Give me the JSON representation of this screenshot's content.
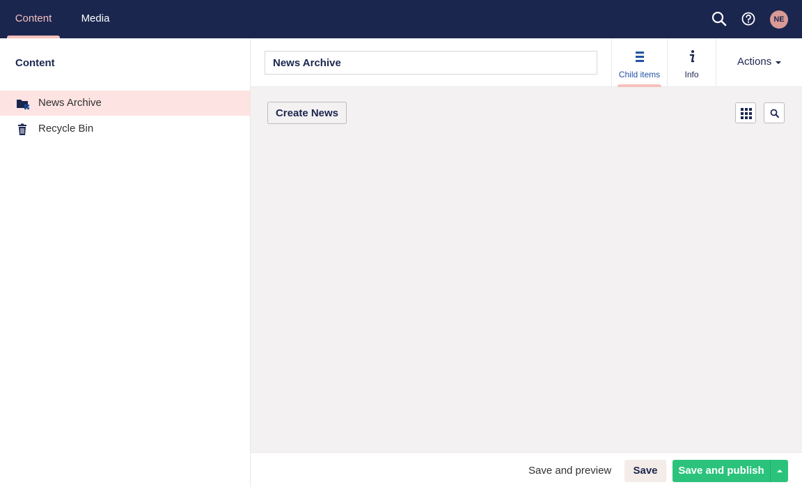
{
  "header": {
    "sections": [
      {
        "label": "Content",
        "active": true
      },
      {
        "label": "Media",
        "active": false
      }
    ],
    "search_icon": "search-icon",
    "help_icon": "help-icon",
    "user_initials": "NE"
  },
  "sidebar": {
    "title": "Content",
    "items": [
      {
        "label": "News Archive",
        "icon": "folder-icon",
        "active": true
      },
      {
        "label": "Recycle Bin",
        "icon": "trash-icon",
        "active": false
      }
    ]
  },
  "editor": {
    "name_value": "News Archive",
    "tabs": [
      {
        "label": "Child items",
        "icon": "list-icon",
        "active": true
      },
      {
        "label": "Info",
        "icon": "info-icon",
        "active": false
      }
    ],
    "actions_label": "Actions"
  },
  "content": {
    "create_label": "Create News",
    "grid_view_icon": "grid-icon",
    "search_icon": "search-icon"
  },
  "footer": {
    "preview_label": "Save and preview",
    "save_label": "Save",
    "publish_label": "Save and publish"
  },
  "colors": {
    "header_bg": "#1b264f",
    "accent": "#f5c1bc",
    "active_row": "#fde3e1",
    "publish_green": "#2bc37c"
  }
}
